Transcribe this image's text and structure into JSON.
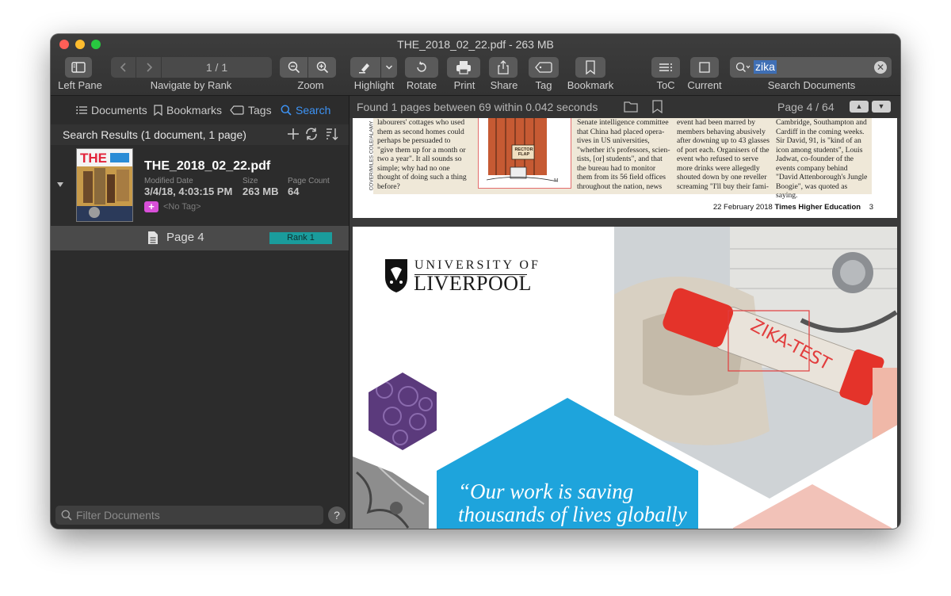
{
  "window": {
    "title": "THE_2018_02_22.pdf - 263 MB"
  },
  "toolbar": {
    "left_pane": "Left Pane",
    "navigate_by_rank": "Navigate by Rank",
    "page_field": "1 / 1",
    "zoom": "Zoom",
    "highlight": "Highlight",
    "rotate": "Rotate",
    "print": "Print",
    "share": "Share",
    "tag": "Tag",
    "bookmark": "Bookmark",
    "toc": "ToC",
    "current": "Current",
    "search_documents": "Search Documents",
    "search_value": "zika"
  },
  "sidebar": {
    "tabs": [
      {
        "label": "Documents"
      },
      {
        "label": "Bookmarks"
      },
      {
        "label": "Tags"
      },
      {
        "label": "Search"
      }
    ],
    "results_title": "Search Results (1 document, 1 page)",
    "document": {
      "name": "THE_2018_02_22.pdf",
      "modified_label": "Modified Date",
      "modified_value": "3/4/18, 4:03:15 PM",
      "size_label": "Size",
      "size_value": "263 MB",
      "page_count_label": "Page Count",
      "page_count_value": "64",
      "tag_placeholder": "<No Tag>"
    },
    "result_row": {
      "page": "Page 4",
      "rank": "Rank 1"
    },
    "filter_placeholder": "Filter Documents",
    "help": "?"
  },
  "main": {
    "found_text": "Found 1 pages between 69 within 0.042 seconds",
    "page_indicator": "Page 4 / 64",
    "page3": {
      "col1": [
        "labourers' cottages who used",
        "them as second homes could",
        "perhaps be persuaded to",
        "\"give them up for a month or",
        "two a year\". It all sounds so",
        "simple; why had no one",
        "thought of doing such a thing",
        "before?"
      ],
      "col2": [
        "Senate intelligence committee",
        "that China had placed opera-",
        "tives in US universities,",
        "\"whether it's professors, scien-",
        "tists, [or] students\", and that",
        "the bureau had to monitor",
        "them from its 56 field offices",
        "throughout the nation, news"
      ],
      "col3": [
        "event had been marred by",
        "members behaving abusively",
        "after downing up to 43 glasses",
        "of port each. Organisers of the",
        "event who refused to serve",
        "more drinks were allegedly",
        "shouted down by one reveller",
        "screaming \"I'll buy their fami-"
      ],
      "col4": [
        "Cambridge, Southampton and",
        "Cardiff in the coming weeks.",
        "Sir David, 91, is \"kind of an",
        "icon among students\", Louis",
        "Jadwat, co-founder of the",
        "events company behind",
        "\"David Attenborough's Jungle",
        "Boogie\", was quoted as saying."
      ],
      "credit": "COVER/MILES COLE/ALAMY",
      "footer_date": "22 February 2018",
      "footer_pub": "Times Higher Education",
      "footer_num": "3",
      "cartoon_sign": "RECTOR FLAP"
    },
    "page4": {
      "uni_line1": "UNIVERSITY OF",
      "uni_line2": "LIVERPOOL",
      "quote_line1": "“Our work is saving",
      "quote_line2": "thousands of lives globally",
      "tube_label": "ZIKA-TEST"
    }
  },
  "colors": {
    "accent": "#3d93f5",
    "rank_badge": "#1a9c9c",
    "tag_add": "#d84fd8",
    "liverpool_blue": "#1ea4dc",
    "window_bg": "#2a2a2a"
  }
}
